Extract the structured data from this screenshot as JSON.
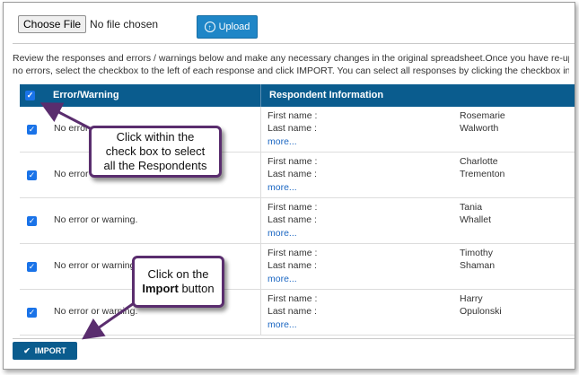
{
  "upload": {
    "choose_label": "Choose File",
    "file_status": "No file chosen",
    "upload_label": "Upload",
    "upload_icon": "up-arrow-circle-icon"
  },
  "instructions": {
    "line1": "Review the responses and errors / warnings below and make any necessary changes in the original spreadsheet.Once you have re-uplo",
    "line2": "no errors, select the checkbox to the left of each response and click IMPORT. You can select all responses by clicking the checkbox in th"
  },
  "table": {
    "headers": {
      "error": "Error/Warning",
      "respondent": "Respondent Information"
    },
    "first_name_label": "First name :",
    "last_name_label": "Last name :",
    "more_label": "more...",
    "rows": [
      {
        "error": "No error",
        "first": "Rosemarie",
        "last": "Walworth"
      },
      {
        "error": "No error",
        "first": "Charlotte",
        "last": "Trementon"
      },
      {
        "error": "No error or warning.",
        "first": "Tania",
        "last": "Whallet"
      },
      {
        "error": "No error or warning.",
        "first": "Timothy",
        "last": "Shaman"
      },
      {
        "error": "No error or warning.",
        "first": "Harry",
        "last": "Opulonski"
      }
    ]
  },
  "import": {
    "label": "IMPORT",
    "icon": "checkmark-icon"
  },
  "callouts": {
    "select_all": "Click within the check box to select all the Respondents",
    "import_prefix": "Click on the",
    "import_bold": "Import",
    "import_suffix": "button"
  },
  "colors": {
    "header_bg": "#0a5c8e",
    "upload_btn": "#1f86c7",
    "checkbox": "#1a73e8",
    "callout_border": "#5a2d6e",
    "link": "#1a66c2"
  }
}
